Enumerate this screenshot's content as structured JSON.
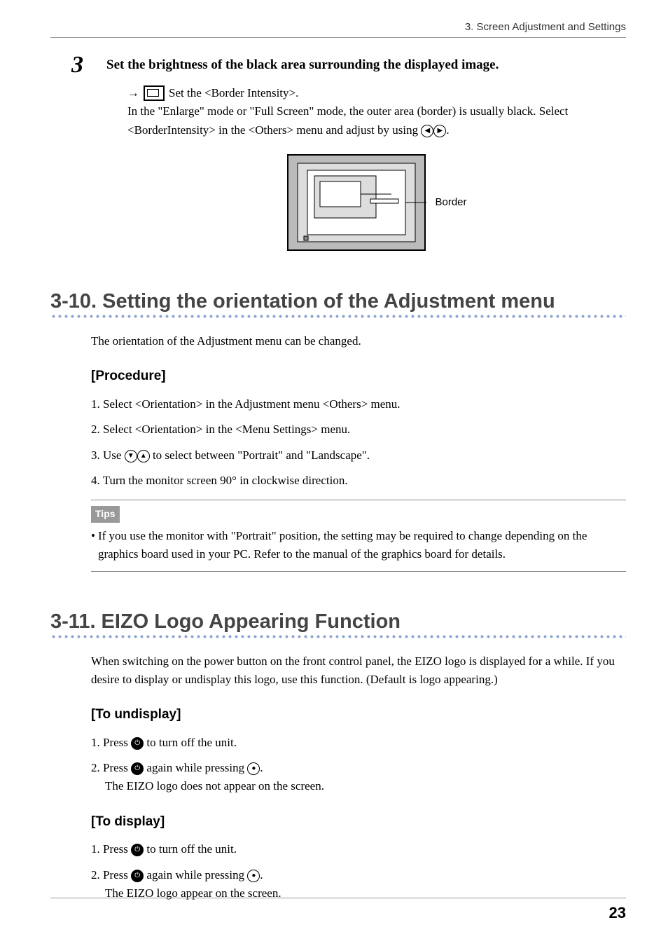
{
  "header": "3. Screen Adjustment and Settings",
  "step3": {
    "number": "3",
    "title": "Set the brightness of the black area surrounding the displayed image.",
    "arrow": "→",
    "set_line": "Set the <Border Intensity>.",
    "para": "In the \"Enlarge\" mode or \"Full Screen\" mode, the outer area (border) is usually black. Select <BorderIntensity> in the <Others> menu and adjust by using ",
    "para_end": ".",
    "diagram_label": "Border"
  },
  "sec310": {
    "title": "3-10. Setting the orientation of the Adjustment menu",
    "intro": "The orientation of the Adjustment menu can be changed.",
    "procedure_heading": "[Procedure]",
    "items": {
      "i1": "1. Select <Orientation> in the Adjustment menu <Others> menu.",
      "i2": "2. Select <Orientation> in the <Menu Settings> menu.",
      "i3_a": "3. Use ",
      "i3_b": " to select between \"Portrait\" and \"Landscape\".",
      "i4": "4. Turn the monitor screen 90° in clockwise direction."
    },
    "tips_label": "Tips",
    "tips_bullet": "•",
    "tips_text": "If you use the monitor with \"Portrait\" position, the setting may be required to change depending on the graphics board used in your PC. Refer to the manual of the graphics board for details."
  },
  "sec311": {
    "title": "3-11. EIZO Logo Appearing Function",
    "intro": "When switching on the power button on the front control panel, the EIZO logo is displayed for a while. If you desire to display or undisplay this logo, use this function. (Default is logo appearing.)",
    "undisplay_heading": "[To undisplay]",
    "undisplay": {
      "i1_a": "1. Press ",
      "i1_b": " to turn off the unit.",
      "i2_a": "2. Press ",
      "i2_b": " again while pressing ",
      "i2_c": ".",
      "i2_sub": "The EIZO logo does not appear on the screen."
    },
    "display_heading": "[To display]",
    "display": {
      "i1_a": "1. Press ",
      "i1_b": " to turn off the unit.",
      "i2_a": "2. Press ",
      "i2_b": " again while pressing ",
      "i2_c": ".",
      "i2_sub": "The EIZO logo appear on the screen."
    }
  },
  "page_number": "23"
}
